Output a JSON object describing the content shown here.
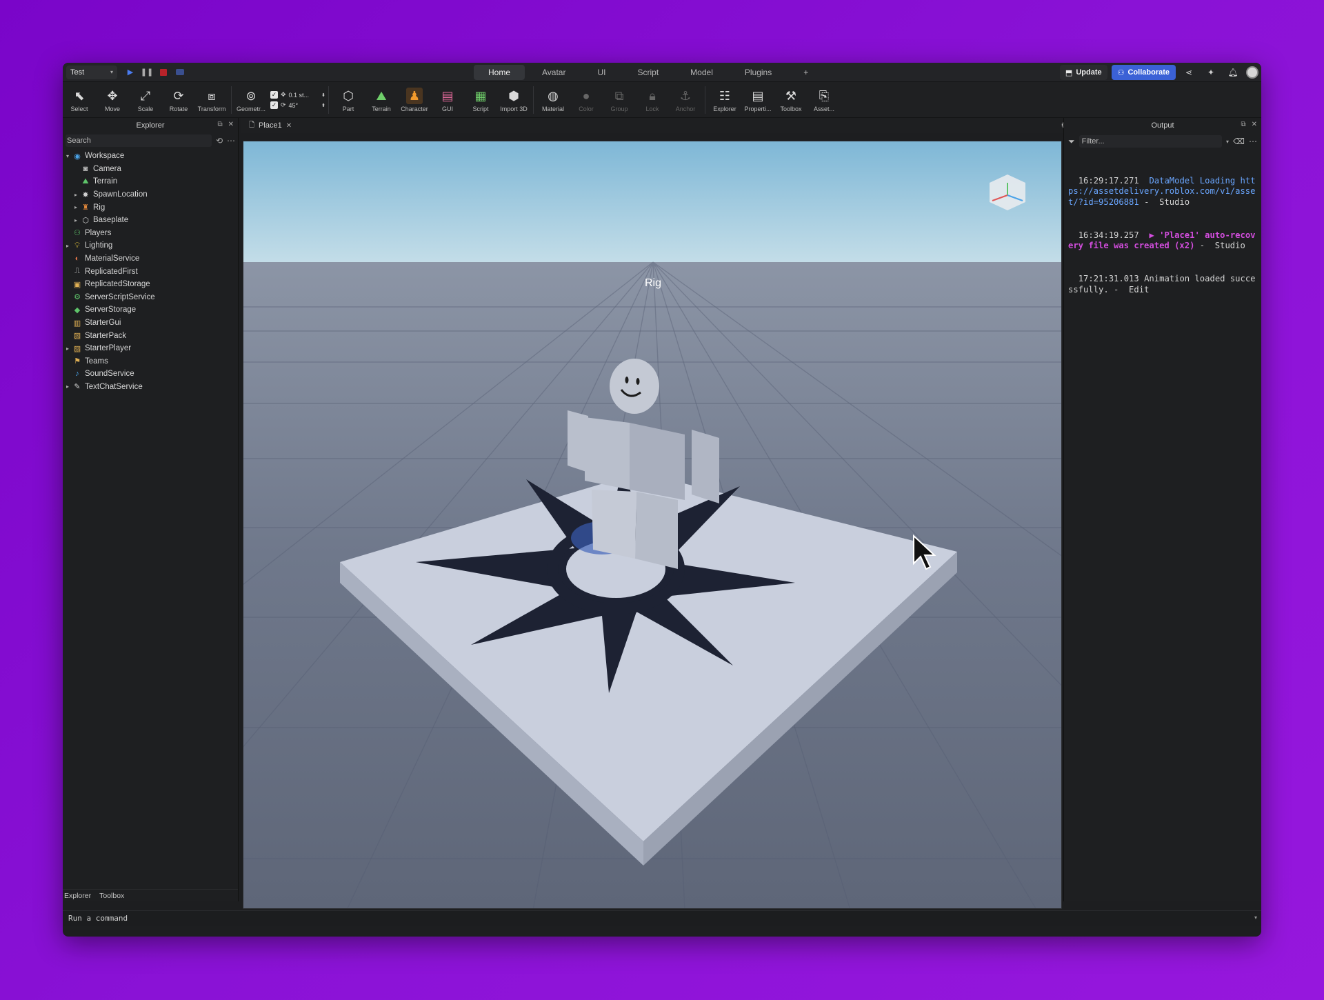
{
  "topbar": {
    "mode": "Test",
    "tabs": [
      "Home",
      "Avatar",
      "UI",
      "Script",
      "Model",
      "Plugins"
    ],
    "active_tab": "Home",
    "add_tab": "+",
    "update_label": "Update",
    "collaborate_label": "Collaborate"
  },
  "ribbon": {
    "select": "Select",
    "move": "Move",
    "scale": "Scale",
    "rotate": "Rotate",
    "transform": "Transform",
    "geometry": "Geometr...",
    "snap_move": "0.1 st...",
    "snap_rotate": "45°",
    "part": "Part",
    "terrain": "Terrain",
    "character": "Character",
    "gui": "GUI",
    "script": "Script",
    "import3d": "Import 3D",
    "material": "Material",
    "color": "Color",
    "group": "Group",
    "lock": "Lock",
    "anchor": "Anchor",
    "explorer": "Explorer",
    "properties": "Properti...",
    "toolbox": "Toolbox",
    "asset": "Asset..."
  },
  "explorer": {
    "title": "Explorer",
    "search_placeholder": "Search",
    "items": [
      {
        "label": "Workspace",
        "depth": 0,
        "arrow": "▾",
        "icon": "workspace-icon",
        "color": "#4aa3e8"
      },
      {
        "label": "Camera",
        "depth": 1,
        "arrow": "",
        "icon": "camera-icon",
        "color": "#bdbdbd"
      },
      {
        "label": "Terrain",
        "depth": 1,
        "arrow": "",
        "icon": "terrain-icon",
        "color": "#5ec46a"
      },
      {
        "label": "SpawnLocation",
        "depth": 1,
        "arrow": "▸",
        "icon": "spawn-icon",
        "color": "#cfcfcf"
      },
      {
        "label": "Rig",
        "depth": 1,
        "arrow": "▸",
        "icon": "rig-icon",
        "color": "#e1873a"
      },
      {
        "label": "Baseplate",
        "depth": 1,
        "arrow": "▸",
        "icon": "part-icon",
        "color": "#cfcfcf"
      },
      {
        "label": "Players",
        "depth": 0,
        "arrow": "",
        "icon": "players-icon",
        "color": "#5ec46a"
      },
      {
        "label": "Lighting",
        "depth": 0,
        "arrow": "▸",
        "icon": "lightbulb-icon",
        "color": "#f2cf3c"
      },
      {
        "label": "MaterialService",
        "depth": 0,
        "arrow": "",
        "icon": "material-service-icon",
        "color": "#e0744a"
      },
      {
        "label": "ReplicatedFirst",
        "depth": 0,
        "arrow": "",
        "icon": "replicated-first-icon",
        "color": "#cfcfcf"
      },
      {
        "label": "ReplicatedStorage",
        "depth": 0,
        "arrow": "",
        "icon": "replicated-storage-icon",
        "color": "#e0b054"
      },
      {
        "label": "ServerScriptService",
        "depth": 0,
        "arrow": "",
        "icon": "server-script-icon",
        "color": "#5ec46a"
      },
      {
        "label": "ServerStorage",
        "depth": 0,
        "arrow": "",
        "icon": "server-storage-icon",
        "color": "#5ec46a"
      },
      {
        "label": "StarterGui",
        "depth": 0,
        "arrow": "",
        "icon": "starter-gui-icon",
        "color": "#e0b054"
      },
      {
        "label": "StarterPack",
        "depth": 0,
        "arrow": "",
        "icon": "starter-pack-icon",
        "color": "#e0b054"
      },
      {
        "label": "StarterPlayer",
        "depth": 0,
        "arrow": "▸",
        "icon": "starter-player-icon",
        "color": "#e0b054"
      },
      {
        "label": "Teams",
        "depth": 0,
        "arrow": "",
        "icon": "teams-icon",
        "color": "#e0b054"
      },
      {
        "label": "SoundService",
        "depth": 0,
        "arrow": "",
        "icon": "sound-icon",
        "color": "#4aa3e8"
      },
      {
        "label": "TextChatService",
        "depth": 0,
        "arrow": "▸",
        "icon": "text-chat-icon",
        "color": "#cfcfcf"
      }
    ],
    "bottom_tabs": [
      "Explorer",
      "Toolbox"
    ]
  },
  "document": {
    "tab_label": "Place1",
    "viewport_label": "Rig"
  },
  "output": {
    "title": "Output",
    "filter_placeholder": "Filter...",
    "log": [
      {
        "time": "16:29:17.271",
        "text": "DataModel Loading",
        "link": "https://assetdelivery.roblox.com/v1/asset/?id=95206881",
        "suffix": " -  Studio",
        "type": "info"
      },
      {
        "time": "16:34:19.257",
        "text": "▶ 'Place1' auto-recovery file was created (x2)",
        "suffix": " -  Studio",
        "type": "warn"
      },
      {
        "time": "17:21:31.013",
        "text": "Animation loaded successfully.",
        "suffix": " -  Edit",
        "type": "normal"
      }
    ]
  },
  "command": {
    "placeholder": "Run a command"
  },
  "colors": {
    "accent": "#3b61d6",
    "link": "#6aa6ff",
    "warning": "#d24ddd",
    "background": "#8a12d6"
  }
}
